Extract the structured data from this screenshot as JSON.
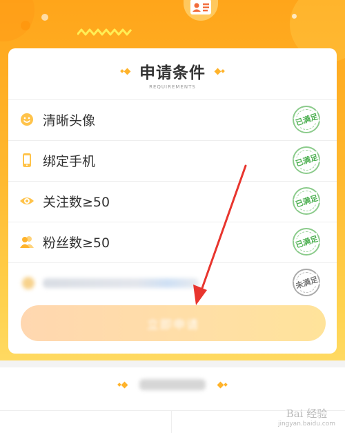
{
  "colors": {
    "accent": "#FFB32B",
    "satisfied": "#4CAF50",
    "annotation_arrow": "#E8352E"
  },
  "requirements": {
    "title": "申请条件",
    "subtitle": "REQUIREMENTS",
    "items": [
      {
        "label": "清晰头像",
        "icon": "smiley-icon",
        "status": "已满足"
      },
      {
        "label": "绑定手机",
        "icon": "phone-icon",
        "status": "已满足"
      },
      {
        "label": "关注数≥50",
        "icon": "eye-icon",
        "status": "已满足"
      },
      {
        "label": "粉丝数≥50",
        "icon": "fans-icon",
        "status": "已满足"
      },
      {
        "label": "",
        "icon": "blurred-icon",
        "status": "未满足"
      }
    ]
  },
  "apply_button": {
    "label": "立即申请"
  },
  "watermark": {
    "main": "Bai 经验",
    "sub": "jingyan.baidu.com"
  }
}
